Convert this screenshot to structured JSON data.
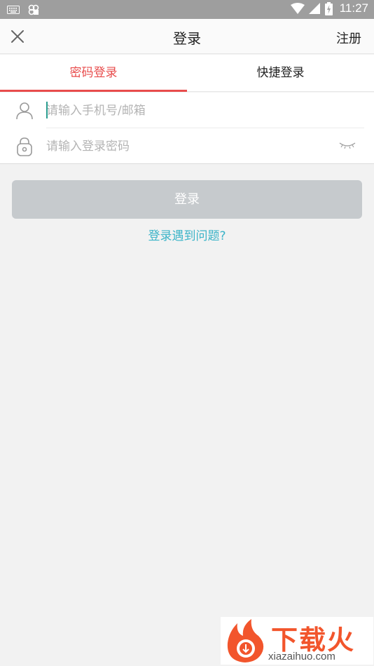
{
  "status_bar": {
    "time": "11:27",
    "icons": [
      "keyboard-icon",
      "app-icon",
      "wifi-icon",
      "signal-icon",
      "battery-icon"
    ]
  },
  "header": {
    "title": "登录",
    "register_label": "注册",
    "close_icon": "close-icon"
  },
  "tabs": [
    {
      "label": "密码登录",
      "active": true
    },
    {
      "label": "快捷登录",
      "active": false
    }
  ],
  "form": {
    "account": {
      "placeholder": "请输入手机号/邮箱",
      "value": ""
    },
    "password": {
      "placeholder": "请输入登录密码",
      "value": ""
    }
  },
  "login_button_label": "登录",
  "trouble_link": "登录遇到问题?",
  "watermark": {
    "brand": "下载火",
    "url": "xiazaihuo.com"
  },
  "colors": {
    "accent": "#e84c4c",
    "link": "#3bb4c8",
    "button_disabled": "#c6cacd",
    "background": "#f2f2f2",
    "status_bar": "#9e9e9e"
  }
}
